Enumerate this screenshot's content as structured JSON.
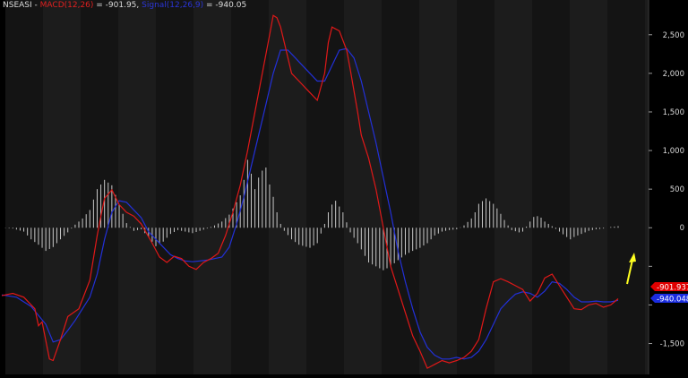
{
  "header": {
    "symbol": "NSEASI",
    "sep": " - ",
    "macd_label": "MACD(12,26)",
    "macd_value": " = -901.95, ",
    "signal_label": "Signal(12,26,9)",
    "signal_value": " = -940.05"
  },
  "colors": {
    "background": "#000000",
    "band_a": "#141414",
    "band_b": "#1c1c1c",
    "macd": "#e01818",
    "signal": "#2230d8",
    "histogram": "#c8c8c8",
    "arrow": "#ffff20",
    "macd_tag": "#e00000",
    "signal_tag": "#1a2ce0"
  },
  "annotations": {
    "arrow": "yellow-up-arrow",
    "macd_tag": "-901.937",
    "signal_tag": "-940.048"
  },
  "chart_data": {
    "type": "line",
    "title": "",
    "xlabel": "",
    "ylabel": "",
    "ylim": [
      -1900,
      2950
    ],
    "yticks": [
      2500,
      2000,
      1500,
      1000,
      500,
      0,
      -500,
      -1000,
      -1500
    ],
    "ytick_labels": [
      "2,500",
      "2,000",
      "1,500",
      "1,000",
      "500",
      "0",
      "",
      "",
      "-1,500"
    ],
    "grid": false,
    "series": [
      {
        "name": "MACD(12,26)",
        "role": "macd",
        "points": [
          [
            0,
            -880
          ],
          [
            3,
            -850
          ],
          [
            6,
            -900
          ],
          [
            9,
            -1050
          ],
          [
            10,
            -1270
          ],
          [
            11,
            -1220
          ],
          [
            13,
            -1700
          ],
          [
            14,
            -1720
          ],
          [
            16,
            -1450
          ],
          [
            18,
            -1150
          ],
          [
            21,
            -1050
          ],
          [
            24,
            -680
          ],
          [
            26,
            -100
          ],
          [
            27,
            150
          ],
          [
            28,
            380
          ],
          [
            30,
            490
          ],
          [
            32,
            300
          ],
          [
            34,
            200
          ],
          [
            36,
            150
          ],
          [
            38,
            50
          ],
          [
            41,
            -200
          ],
          [
            43,
            -380
          ],
          [
            45,
            -450
          ],
          [
            47,
            -370
          ],
          [
            49,
            -400
          ],
          [
            51,
            -500
          ],
          [
            53,
            -540
          ],
          [
            55,
            -450
          ],
          [
            57,
            -400
          ],
          [
            59,
            -330
          ],
          [
            61,
            -100
          ],
          [
            63,
            200
          ],
          [
            65,
            550
          ],
          [
            67,
            1000
          ],
          [
            69,
            1500
          ],
          [
            71,
            2000
          ],
          [
            73,
            2500
          ],
          [
            74,
            2750
          ],
          [
            75,
            2720
          ],
          [
            76,
            2600
          ],
          [
            77,
            2400
          ],
          [
            79,
            2000
          ],
          [
            81,
            1900
          ],
          [
            84,
            1750
          ],
          [
            86,
            1650
          ],
          [
            88,
            2000
          ],
          [
            89,
            2400
          ],
          [
            90,
            2600
          ],
          [
            92,
            2550
          ],
          [
            94,
            2300
          ],
          [
            95,
            2050
          ],
          [
            97,
            1500
          ],
          [
            98,
            1200
          ],
          [
            100,
            900
          ],
          [
            102,
            500
          ],
          [
            104,
            0
          ],
          [
            106,
            -500
          ],
          [
            108,
            -800
          ],
          [
            110,
            -1100
          ],
          [
            112,
            -1400
          ],
          [
            114,
            -1600
          ],
          [
            116,
            -1820
          ],
          [
            118,
            -1770
          ],
          [
            120,
            -1720
          ],
          [
            122,
            -1750
          ],
          [
            124,
            -1720
          ],
          [
            126,
            -1680
          ],
          [
            128,
            -1600
          ],
          [
            130,
            -1450
          ],
          [
            132,
            -1050
          ],
          [
            134,
            -700
          ],
          [
            136,
            -660
          ],
          [
            138,
            -700
          ],
          [
            140,
            -750
          ],
          [
            142,
            -800
          ],
          [
            144,
            -950
          ],
          [
            146,
            -850
          ],
          [
            148,
            -650
          ],
          [
            150,
            -600
          ],
          [
            152,
            -750
          ],
          [
            154,
            -900
          ],
          [
            156,
            -1050
          ],
          [
            158,
            -1060
          ],
          [
            160,
            -1000
          ],
          [
            162,
            -980
          ],
          [
            164,
            -1030
          ],
          [
            166,
            -1000
          ],
          [
            168,
            -920
          ]
        ]
      },
      {
        "name": "Signal(12,26,9)",
        "role": "signal",
        "points": [
          [
            0,
            -870
          ],
          [
            4,
            -900
          ],
          [
            8,
            -1020
          ],
          [
            12,
            -1250
          ],
          [
            14,
            -1480
          ],
          [
            16,
            -1450
          ],
          [
            18,
            -1330
          ],
          [
            20,
            -1200
          ],
          [
            22,
            -1050
          ],
          [
            24,
            -900
          ],
          [
            26,
            -600
          ],
          [
            28,
            -150
          ],
          [
            30,
            200
          ],
          [
            32,
            350
          ],
          [
            34,
            330
          ],
          [
            36,
            230
          ],
          [
            38,
            130
          ],
          [
            40,
            -50
          ],
          [
            42,
            -150
          ],
          [
            44,
            -250
          ],
          [
            46,
            -350
          ],
          [
            48,
            -400
          ],
          [
            50,
            -430
          ],
          [
            52,
            -440
          ],
          [
            54,
            -430
          ],
          [
            56,
            -420
          ],
          [
            58,
            -400
          ],
          [
            60,
            -380
          ],
          [
            62,
            -250
          ],
          [
            64,
            50
          ],
          [
            66,
            400
          ],
          [
            68,
            800
          ],
          [
            70,
            1200
          ],
          [
            72,
            1600
          ],
          [
            74,
            2000
          ],
          [
            76,
            2300
          ],
          [
            78,
            2300
          ],
          [
            80,
            2200
          ],
          [
            82,
            2100
          ],
          [
            84,
            2000
          ],
          [
            86,
            1900
          ],
          [
            88,
            1900
          ],
          [
            90,
            2100
          ],
          [
            92,
            2300
          ],
          [
            94,
            2320
          ],
          [
            96,
            2200
          ],
          [
            98,
            1900
          ],
          [
            100,
            1500
          ],
          [
            102,
            1100
          ],
          [
            104,
            650
          ],
          [
            106,
            200
          ],
          [
            108,
            -300
          ],
          [
            110,
            -700
          ],
          [
            112,
            -1050
          ],
          [
            114,
            -1350
          ],
          [
            116,
            -1550
          ],
          [
            118,
            -1650
          ],
          [
            120,
            -1700
          ],
          [
            122,
            -1700
          ],
          [
            124,
            -1680
          ],
          [
            126,
            -1700
          ],
          [
            128,
            -1680
          ],
          [
            130,
            -1600
          ],
          [
            132,
            -1450
          ],
          [
            134,
            -1250
          ],
          [
            136,
            -1050
          ],
          [
            138,
            -950
          ],
          [
            140,
            -860
          ],
          [
            142,
            -830
          ],
          [
            144,
            -850
          ],
          [
            146,
            -900
          ],
          [
            148,
            -820
          ],
          [
            150,
            -700
          ],
          [
            152,
            -720
          ],
          [
            154,
            -800
          ],
          [
            156,
            -900
          ],
          [
            158,
            -960
          ],
          [
            160,
            -960
          ],
          [
            162,
            -950
          ],
          [
            164,
            -960
          ],
          [
            166,
            -960
          ],
          [
            168,
            -940
          ]
        ]
      },
      {
        "name": "",
        "role": "histogram",
        "type": "bar",
        "points": [
          [
            0,
            0
          ],
          [
            3,
            -10
          ],
          [
            6,
            -50
          ],
          [
            8,
            -150
          ],
          [
            10,
            -220
          ],
          [
            12,
            -300
          ],
          [
            14,
            -250
          ],
          [
            16,
            -150
          ],
          [
            18,
            -60
          ],
          [
            20,
            40
          ],
          [
            22,
            120
          ],
          [
            24,
            230
          ],
          [
            26,
            500
          ],
          [
            28,
            620
          ],
          [
            30,
            550
          ],
          [
            32,
            300
          ],
          [
            34,
            60
          ],
          [
            36,
            -40
          ],
          [
            38,
            -20
          ],
          [
            40,
            -120
          ],
          [
            42,
            -240
          ],
          [
            44,
            -180
          ],
          [
            46,
            -80
          ],
          [
            48,
            -30
          ],
          [
            50,
            -50
          ],
          [
            52,
            -70
          ],
          [
            54,
            -40
          ],
          [
            56,
            -10
          ],
          [
            58,
            30
          ],
          [
            60,
            80
          ],
          [
            62,
            170
          ],
          [
            64,
            330
          ],
          [
            65,
            420
          ],
          [
            66,
            620
          ],
          [
            67,
            880
          ],
          [
            68,
            700
          ],
          [
            69,
            500
          ],
          [
            70,
            650
          ],
          [
            71,
            740
          ],
          [
            72,
            780
          ],
          [
            73,
            560
          ],
          [
            74,
            400
          ],
          [
            75,
            200
          ],
          [
            76,
            50
          ],
          [
            77,
            -40
          ],
          [
            79,
            -150
          ],
          [
            81,
            -220
          ],
          [
            84,
            -260
          ],
          [
            86,
            -200
          ],
          [
            88,
            50
          ],
          [
            89,
            200
          ],
          [
            90,
            300
          ],
          [
            91,
            350
          ],
          [
            93,
            200
          ],
          [
            95,
            -60
          ],
          [
            97,
            -200
          ],
          [
            98,
            -280
          ],
          [
            100,
            -450
          ],
          [
            102,
            -500
          ],
          [
            104,
            -550
          ],
          [
            106,
            -500
          ],
          [
            108,
            -420
          ],
          [
            110,
            -350
          ],
          [
            112,
            -300
          ],
          [
            114,
            -260
          ],
          [
            116,
            -200
          ],
          [
            118,
            -100
          ],
          [
            120,
            -50
          ],
          [
            122,
            -30
          ],
          [
            124,
            -20
          ],
          [
            126,
            30
          ],
          [
            128,
            120
          ],
          [
            129,
            200
          ],
          [
            130,
            310
          ],
          [
            132,
            380
          ],
          [
            134,
            310
          ],
          [
            135,
            250
          ],
          [
            136,
            180
          ],
          [
            137,
            100
          ],
          [
            138,
            30
          ],
          [
            139,
            -30
          ],
          [
            141,
            -60
          ],
          [
            142,
            -50
          ],
          [
            144,
            80
          ],
          [
            145,
            140
          ],
          [
            146,
            150
          ],
          [
            147,
            130
          ],
          [
            148,
            80
          ],
          [
            150,
            20
          ],
          [
            152,
            -50
          ],
          [
            154,
            -120
          ],
          [
            155,
            -150
          ],
          [
            156,
            -120
          ],
          [
            158,
            -80
          ],
          [
            160,
            -40
          ],
          [
            162,
            -20
          ],
          [
            164,
            -10
          ],
          [
            166,
            10
          ],
          [
            168,
            20
          ]
        ]
      }
    ]
  }
}
